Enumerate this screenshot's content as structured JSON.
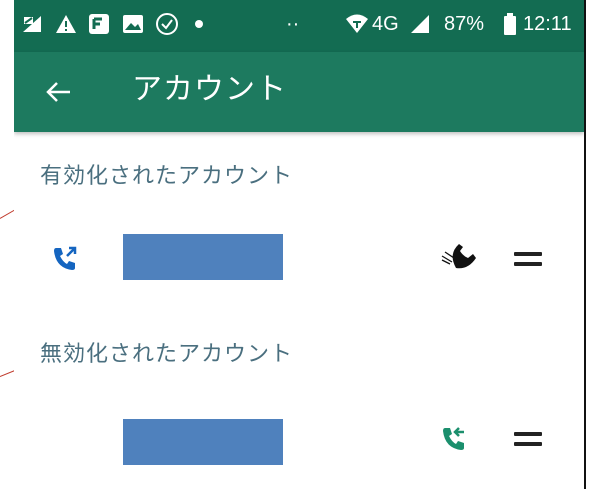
{
  "status_bar": {
    "network": "4G",
    "battery": "87%",
    "time": "12:11",
    "dots": "··"
  },
  "app_bar": {
    "title": "アカウント"
  },
  "sections": {
    "enabled_title": "有効化されたアカウント",
    "disabled_title": "無効化されたアカウント"
  },
  "colors": {
    "status_bar": "#136c52",
    "app_bar": "#1d7a5f",
    "section_title": "#4a6f7f",
    "redacted_name": "#4f81bd",
    "call_blue": "#1565c0",
    "call_green": "#1b8f6d"
  },
  "icons": {
    "enabled_call": "outgoing-call-icon",
    "enabled_push": "push-phone-icon",
    "disabled_call": "incoming-call-icon",
    "drag": "drag-handle-icon"
  }
}
